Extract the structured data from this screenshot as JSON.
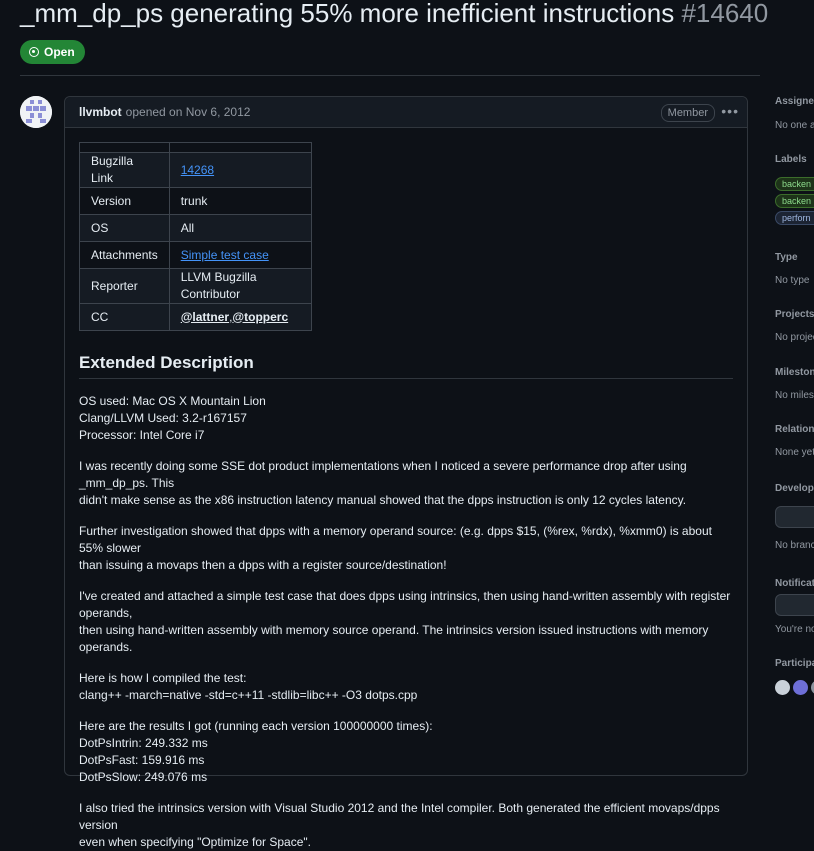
{
  "issue": {
    "title": "_mm_dp_ps generating 55% more inefficient instructions",
    "number": "#14640",
    "state": "Open"
  },
  "comment": {
    "author": "llvmbot",
    "action": "opened on Nov 6, 2012",
    "role_badge": "Member",
    "menu_icon": "kebab-horizontal-icon",
    "meta_table": [
      {
        "key": "Bugzilla Link",
        "value": "14268",
        "link": true
      },
      {
        "key": "Version",
        "value": "trunk",
        "link": false
      },
      {
        "key": "OS",
        "value": "All",
        "link": false
      },
      {
        "key": "Attachments",
        "value": "Simple test case",
        "link": true
      },
      {
        "key": "Reporter",
        "value": "LLVM Bugzilla Contributor",
        "link": false
      }
    ],
    "cc_label": "CC",
    "cc_values": [
      "@lattner",
      "@topperc"
    ],
    "cc_sep": ",",
    "heading": "Extended Description",
    "paragraphs": [
      [
        "OS used: Mac OS X Mountain Lion",
        "Clang/LLVM Used: 3.2-r167157",
        "Processor: Intel Core i7"
      ],
      [
        "I was recently doing some SSE dot product implementations when I noticed a severe performance drop after using _mm_dp_ps. This",
        "didn't make sense as the x86 instruction latency manual showed that the dpps instruction is only 12 cycles latency."
      ],
      [
        "Further investigation showed that dpps with a memory operand source: (e.g. dpps $15, (%rex, %rdx), %xmm0) is about 55% slower",
        "than issuing a movaps then a dpps with a register source/destination!"
      ],
      [
        "I've created and attached a simple test case that does dpps using intrinsics, then using hand-written assembly with register operands,",
        "then using hand-written assembly with memory source operand. The intrinsics version issued instructions with memory operands."
      ],
      [
        "Here is how I compiled the test:",
        "clang++ -march=native -std=c++11 -stdlib=libc++ -O3 dotps.cpp"
      ],
      [
        "Here are the results I got (running each version 100000000 times):",
        "DotPsIntrin: 249.332 ms",
        "DotPsFast: 159.916 ms",
        "DotPsSlow: 249.076 ms"
      ],
      [
        "I also tried the intrinsics version with Visual Studio 2012 and the Intel compiler. Both generated the efficient movaps/dpps version",
        "even when specifying \"Optimize for Space\"."
      ]
    ]
  },
  "sidebar": {
    "assignees": {
      "label": "Assignee",
      "value": "No one a"
    },
    "labels": {
      "label": "Labels",
      "items": [
        "backen",
        "backen",
        "perforn"
      ],
      "colors": [
        "#8ddb8c",
        "#8ddb8c",
        "#9fb7e0"
      ]
    },
    "type": {
      "label": "Type",
      "value": "No type"
    },
    "projects": {
      "label": "Projects",
      "value": "No projec"
    },
    "milestone": {
      "label": "Milestone",
      "value": "No milest"
    },
    "relationships": {
      "label": "Relations",
      "value": "None yet"
    },
    "development": {
      "label": "Developm",
      "value": "No branc"
    },
    "notifications": {
      "label": "Notificatio",
      "value": "You're no"
    },
    "participants": {
      "label": "Participan"
    }
  }
}
